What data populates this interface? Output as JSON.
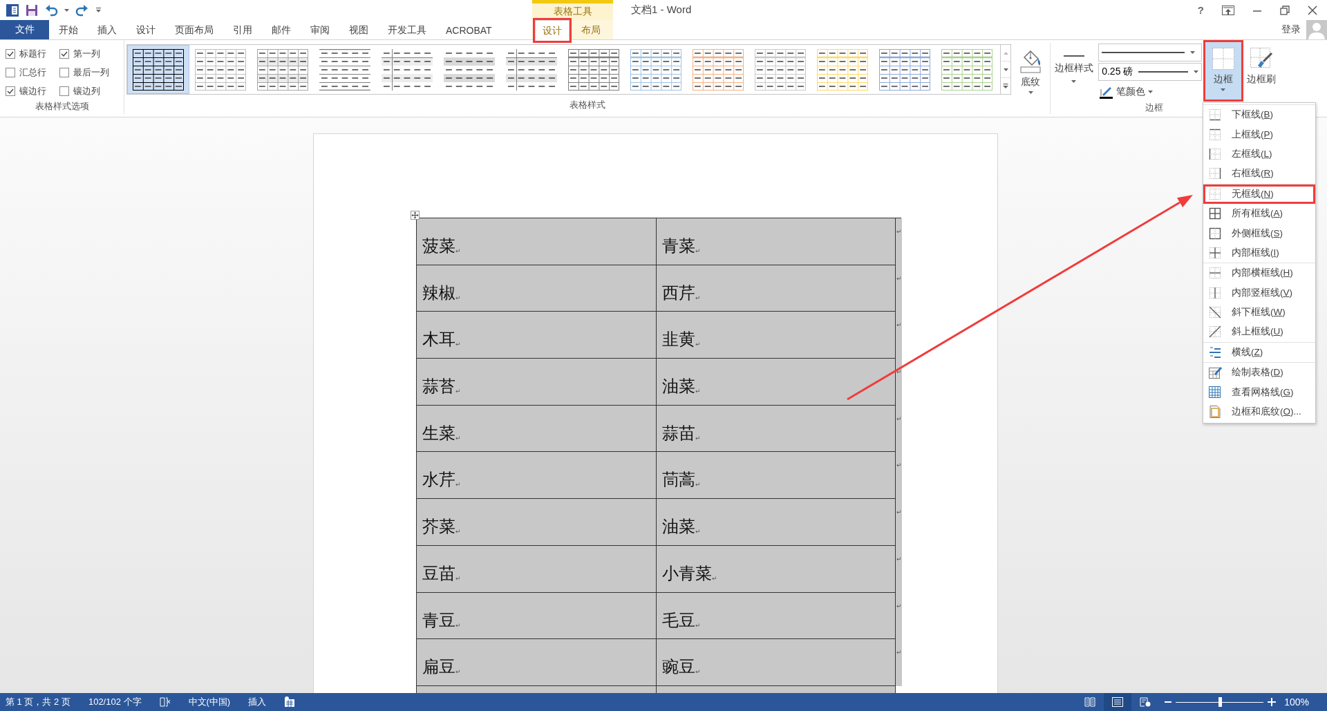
{
  "window": {
    "context_group": "表格工具",
    "title": "文档1 - Word",
    "help": "?"
  },
  "tabs": [
    {
      "label": "文件",
      "kind": "file",
      "selected": false,
      "highlighted": false
    },
    {
      "label": "开始",
      "kind": "main",
      "selected": false,
      "highlighted": false
    },
    {
      "label": "插入",
      "kind": "main",
      "selected": false,
      "highlighted": false
    },
    {
      "label": "设计",
      "kind": "main",
      "selected": false,
      "highlighted": false
    },
    {
      "label": "页面布局",
      "kind": "main",
      "selected": false,
      "highlighted": false
    },
    {
      "label": "引用",
      "kind": "main",
      "selected": false,
      "highlighted": false
    },
    {
      "label": "邮件",
      "kind": "main",
      "selected": false,
      "highlighted": false
    },
    {
      "label": "审阅",
      "kind": "main",
      "selected": false,
      "highlighted": false
    },
    {
      "label": "视图",
      "kind": "main",
      "selected": false,
      "highlighted": false
    },
    {
      "label": "开发工具",
      "kind": "main",
      "selected": false,
      "highlighted": false
    },
    {
      "label": "ACROBAT",
      "kind": "main",
      "selected": false,
      "highlighted": false
    },
    {
      "label": "设计",
      "kind": "context",
      "selected": true,
      "highlighted": true
    },
    {
      "label": "布局",
      "kind": "context",
      "selected": false,
      "highlighted": false
    }
  ],
  "account": {
    "label": "登录"
  },
  "style_options": {
    "label": "表格样式选项",
    "options": [
      {
        "label": "标题行",
        "checked": true
      },
      {
        "label": "第一列",
        "checked": true
      },
      {
        "label": "汇总行",
        "checked": false
      },
      {
        "label": "最后一列",
        "checked": false
      },
      {
        "label": "镶边行",
        "checked": true
      },
      {
        "label": "镶边列",
        "checked": false
      }
    ]
  },
  "table_styles": {
    "label": "表格样式",
    "styles": [
      {
        "kind": "grid",
        "color": "#000000",
        "selected": true
      },
      {
        "kind": "grid",
        "color": "#bfbfbf",
        "selected": false
      },
      {
        "kind": "banded-grid",
        "color": "#a6a6a6",
        "selected": false
      },
      {
        "kind": "lines",
        "color": "#7f7f7f",
        "selected": false
      },
      {
        "kind": "column",
        "color": "#ededed",
        "selected": false
      },
      {
        "kind": "banded",
        "color": "#d9d9d9",
        "selected": false
      },
      {
        "kind": "column",
        "color": "#e4e4e4",
        "selected": false
      },
      {
        "kind": "header-grid",
        "color": "#7f7f7f",
        "selected": false
      },
      {
        "kind": "header-grid",
        "color": "#9dc3e6",
        "selected": false
      },
      {
        "kind": "header-grid",
        "color": "#f4b183",
        "selected": false
      },
      {
        "kind": "header-grid",
        "color": "#c9c9c9",
        "selected": false
      },
      {
        "kind": "header-grid",
        "color": "#ffd966",
        "selected": false
      },
      {
        "kind": "header-grid",
        "color": "#8eaadb",
        "selected": false
      },
      {
        "kind": "header-grid",
        "color": "#a9d18e",
        "selected": false
      }
    ]
  },
  "shading": {
    "label": "底纹"
  },
  "borders": {
    "label": "边框",
    "border_styles": "边框样式",
    "line_weight": "0.25 磅",
    "pen_color": "笔颜色",
    "borders_button": {
      "label": "边框",
      "expanded": true,
      "highlighted": true
    },
    "border_painter": "边框刷"
  },
  "borders_menu": [
    [
      {
        "kind": "bottom",
        "prefix": "下框线(",
        "key": "B",
        "suffix": ")",
        "highlighted": false
      },
      {
        "kind": "top",
        "prefix": "上框线(",
        "key": "P",
        "suffix": ")",
        "highlighted": false
      },
      {
        "kind": "left",
        "prefix": "左框线(",
        "key": "L",
        "suffix": ")",
        "highlighted": false
      },
      {
        "kind": "right",
        "prefix": "右框线(",
        "key": "R",
        "suffix": ")",
        "highlighted": false
      }
    ],
    [
      {
        "kind": "none",
        "prefix": "无框线(",
        "key": "N",
        "suffix": ")",
        "highlighted": true
      },
      {
        "kind": "all",
        "prefix": "所有框线(",
        "key": "A",
        "suffix": ")",
        "highlighted": false
      },
      {
        "kind": "outside",
        "prefix": "外侧框线(",
        "key": "S",
        "suffix": ")",
        "highlighted": false
      },
      {
        "kind": "inside",
        "prefix": "内部框线(",
        "key": "I",
        "suffix": ")",
        "highlighted": false
      }
    ],
    [
      {
        "kind": "inside-h",
        "prefix": "内部横框线(",
        "key": "H",
        "suffix": ")",
        "highlighted": false
      },
      {
        "kind": "inside-v",
        "prefix": "内部竖框线(",
        "key": "V",
        "suffix": ")",
        "highlighted": false
      },
      {
        "kind": "diag-down",
        "prefix": "斜下框线(",
        "key": "W",
        "suffix": ")",
        "highlighted": false
      },
      {
        "kind": "diag-up",
        "prefix": "斜上框线(",
        "key": "U",
        "suffix": ")",
        "highlighted": false
      }
    ],
    [
      {
        "kind": "hline",
        "prefix": "横线(",
        "key": "Z",
        "suffix": ")",
        "highlighted": false
      }
    ],
    [
      {
        "kind": "draw",
        "prefix": "绘制表格(",
        "key": "D",
        "suffix": ")",
        "highlighted": false
      },
      {
        "kind": "gridlines",
        "prefix": "查看网格线(",
        "key": "G",
        "suffix": ")",
        "highlighted": false
      },
      {
        "kind": "dialog",
        "prefix": "边框和底纹(",
        "key": "O",
        "suffix": ")...",
        "highlighted": false
      }
    ]
  ],
  "document": {
    "rows": [
      {
        "cells": [
          "菠菜$_{↵}$",
          "青菜$_{↵}$"
        ],
        "end_mark": "↵"
      },
      {
        "cells": [
          "辣椒$_{↵}$",
          "西芹$_{↵}$"
        ],
        "end_mark": "↵"
      },
      {
        "cells": [
          "木耳$_{↵}$",
          "韭黄$_{↵}$"
        ],
        "end_mark": "↵"
      },
      {
        "cells": [
          "蒜苔$_{↵}$",
          "油菜$_{↵}$"
        ],
        "end_mark": "↵"
      },
      {
        "cells": [
          "生菜$_{↵}$",
          "蒜苗$_{↵}$"
        ],
        "end_mark": "↵"
      },
      {
        "cells": [
          "水芹$_{↵}$",
          "茼蒿$_{↵}$"
        ],
        "end_mark": "↵"
      },
      {
        "cells": [
          "芥菜$_{↵}$",
          "油菜$_{↵}$"
        ],
        "end_mark": "↵"
      },
      {
        "cells": [
          "豆苗$_{↵}$",
          "小青菜$_{↵}$"
        ],
        "end_mark": "↵"
      },
      {
        "cells": [
          "青豆$_{↵}$",
          "毛豆$_{↵}$"
        ],
        "end_mark": "↵"
      },
      {
        "cells": [
          "扁豆$_{↵}$",
          "豌豆$_{↵}$"
        ],
        "end_mark": "↵"
      }
    ]
  },
  "status_bar": {
    "page": "第 1 页，共 2 页",
    "words": "102/102 个字",
    "language": "中文(中国)",
    "mode": "插入",
    "views": [
      {
        "kind": "read",
        "selected": false
      },
      {
        "kind": "print",
        "selected": true
      },
      {
        "kind": "web",
        "selected": false
      }
    ],
    "zoom": {
      "level": 0.5,
      "reading": "100%"
    }
  }
}
